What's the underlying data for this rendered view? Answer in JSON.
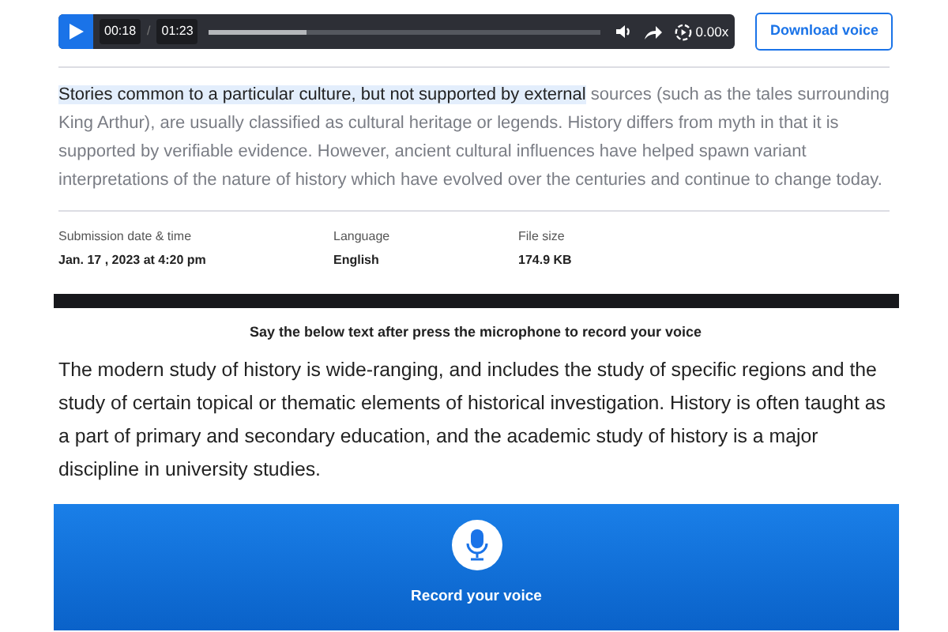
{
  "player": {
    "current_time": "00:18",
    "separator": "/",
    "duration": "01:23",
    "level": 0.25,
    "speed": "0.00x"
  },
  "download_button": "Download voice",
  "passage": {
    "highlighted": "Stories common to a particular culture, but not supported by external",
    "rest": " sources (such as the tales surrounding King Arthur), are usually classified as cultural heritage or legends. History differs from myth in that it is supported by verifiable evidence. However, ancient cultural influences have helped spawn variant interpretations of the nature of history which have evolved over the centuries and continue to change today."
  },
  "details": [
    {
      "label": "Submission date & time",
      "value": "Jan. 17 , 2023 at 4:20 pm"
    },
    {
      "label": "Language",
      "value": "English"
    },
    {
      "label": "File size",
      "value": "174.9 KB"
    }
  ],
  "instruction": "Say the below text after press the microphone to record your voice",
  "reading_text": "The modern study of history is wide-ranging, and includes the study of specific regions and the study of certain topical or thematic elements of historical investigation. History is often taught as a part of primary and secondary education, and the academic study of history is a major discipline in university studies.",
  "record_button": "Record your voice"
}
